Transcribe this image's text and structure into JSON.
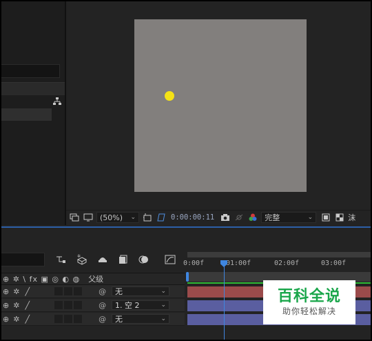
{
  "viewer": {
    "zoom_label": "(50%)",
    "timecode": "0:00:00:11",
    "quality_label": "完整",
    "cut_label": "沫"
  },
  "timeline": {
    "header": {
      "icons": "⊕ ✲ \\ fx ▣ ◎ ◐ ◍",
      "parent_label": "父级"
    },
    "layers": [
      {
        "parent": "无"
      },
      {
        "parent": "1. 空 2"
      },
      {
        "parent": "无"
      }
    ],
    "ruler": [
      "0:00f",
      "01:00f",
      "02:00f",
      "03:00f"
    ],
    "track_colors": [
      "#9b4b4b",
      "#5a5ea0",
      "#5a5ea0"
    ]
  },
  "watermark": {
    "title": "百科全说",
    "subtitle": "助你轻松解决"
  },
  "colors": {
    "accent": "#3f86e0",
    "comp_bg": "#827f7d",
    "dot": "#f5e215",
    "work_area_line": "#2ebb34"
  }
}
